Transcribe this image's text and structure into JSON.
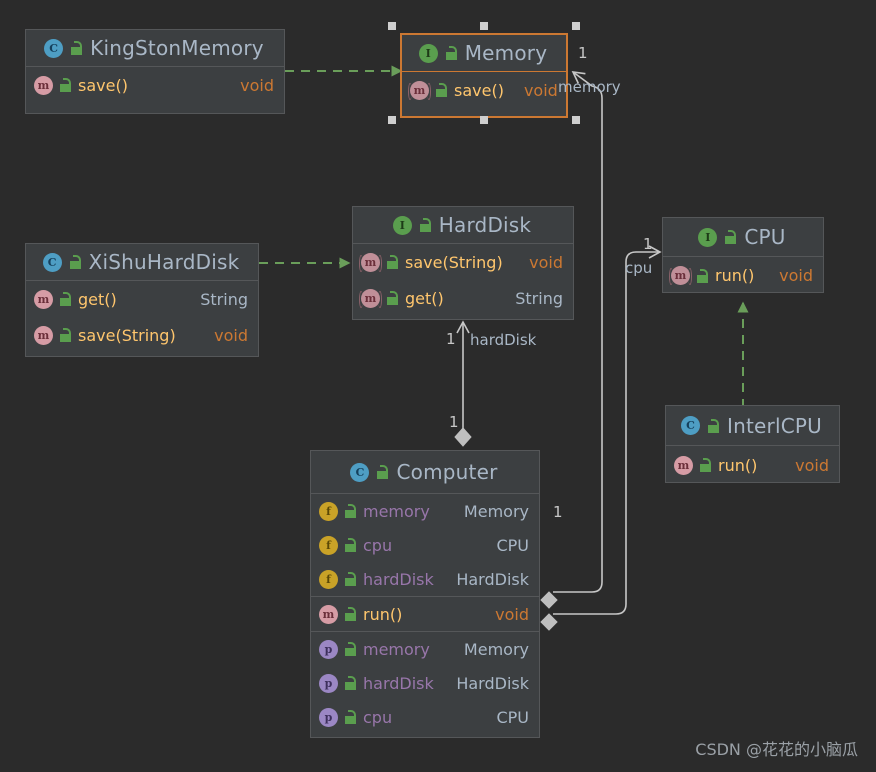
{
  "diagram": {
    "background": "#2b2b2b",
    "title": "UML Class Diagram",
    "colors": {
      "box_fill": "#3c3f41",
      "box_border": "#555759",
      "selection": "#cc7832",
      "inheritance": "#6a9e5a",
      "association": "#c7c7c7",
      "method_name": "#ffc66d",
      "field_name": "#9876aa",
      "type_void": "#cc7832",
      "type_ref": "#a9b7c6",
      "class_icon": "#4e9ec4",
      "interface_icon": "#5a9e4e",
      "method_icon": "#d69ca5",
      "field_icon": "#c9a227",
      "property_icon": "#9b87c4",
      "lock_icon": "#5a9e4e"
    }
  },
  "classes": {
    "kingstonmemory": {
      "name": "KingStonMemory",
      "stereotype_icon": "class-icon",
      "visibility_icon": "unlock-icon",
      "selected": false,
      "members": [
        {
          "icon": "method-icon",
          "abstract": false,
          "name": "save()",
          "type": "void",
          "type_kind": "void"
        }
      ]
    },
    "memory": {
      "name": "Memory",
      "stereotype_icon": "interface-icon",
      "visibility_icon": "unlock-icon",
      "selected": true,
      "members": [
        {
          "icon": "abstract-method-icon",
          "abstract": true,
          "name": "save()",
          "type": "void",
          "type_kind": "void"
        }
      ]
    },
    "xishuharddisk": {
      "name": "XiShuHardDisk",
      "stereotype_icon": "class-icon",
      "visibility_icon": "unlock-icon",
      "selected": false,
      "members": [
        {
          "icon": "method-icon",
          "abstract": false,
          "name": "get()",
          "type": "String",
          "type_kind": "ref"
        },
        {
          "icon": "method-icon",
          "abstract": false,
          "name": "save(String)",
          "type": "void",
          "type_kind": "void"
        }
      ]
    },
    "harddisk": {
      "name": "HardDisk",
      "stereotype_icon": "interface-icon",
      "visibility_icon": "unlock-icon",
      "selected": false,
      "members": [
        {
          "icon": "abstract-method-icon",
          "abstract": true,
          "name": "save(String)",
          "type": "void",
          "type_kind": "void"
        },
        {
          "icon": "abstract-method-icon",
          "abstract": true,
          "name": "get()",
          "type": "String",
          "type_kind": "ref"
        }
      ]
    },
    "cpu": {
      "name": "CPU",
      "stereotype_icon": "interface-icon",
      "visibility_icon": "unlock-icon",
      "selected": false,
      "members": [
        {
          "icon": "abstract-method-icon",
          "abstract": true,
          "name": "run()",
          "type": "void",
          "type_kind": "void"
        }
      ]
    },
    "interlcpu": {
      "name": "InterlCPU",
      "stereotype_icon": "class-icon",
      "visibility_icon": "unlock-icon",
      "selected": false,
      "members": [
        {
          "icon": "method-icon",
          "abstract": false,
          "name": "run()",
          "type": "void",
          "type_kind": "void"
        }
      ]
    },
    "computer": {
      "name": "Computer",
      "stereotype_icon": "class-icon",
      "visibility_icon": "unlock-icon",
      "selected": false,
      "fields": [
        {
          "icon": "field-icon",
          "name": "memory",
          "type": "Memory"
        },
        {
          "icon": "field-icon",
          "name": "cpu",
          "type": "CPU"
        },
        {
          "icon": "field-icon",
          "name": "hardDisk",
          "type": "HardDisk"
        }
      ],
      "methods": [
        {
          "icon": "method-icon",
          "name": "run()",
          "type": "void",
          "type_kind": "void"
        }
      ],
      "properties": [
        {
          "icon": "property-icon",
          "name": "memory",
          "type": "Memory"
        },
        {
          "icon": "property-icon",
          "name": "hardDisk",
          "type": "HardDisk"
        },
        {
          "icon": "property-icon",
          "name": "cpu",
          "type": "CPU"
        }
      ]
    }
  },
  "relations": {
    "kingstonmemory_memory": {
      "kind": "realization",
      "style": "dashed-green",
      "from": "KingStonMemory",
      "to": "Memory"
    },
    "xishuharddisk_harddisk": {
      "kind": "realization",
      "style": "dashed-green",
      "from": "XiShuHardDisk",
      "to": "HardDisk"
    },
    "interlcpu_cpu": {
      "kind": "realization",
      "style": "dashed-green",
      "from": "InterlCPU",
      "to": "CPU"
    },
    "computer_memory": {
      "kind": "aggregation",
      "style": "solid-gray",
      "from": "Computer",
      "to": "Memory",
      "label": "memory",
      "target_multiplicity": "1",
      "source_multiplicity": "1"
    },
    "computer_cpu": {
      "kind": "aggregation",
      "style": "solid-gray",
      "from": "Computer",
      "to": "CPU",
      "label": "cpu",
      "target_multiplicity": "1",
      "source_multiplicity": "1"
    },
    "computer_harddisk": {
      "kind": "aggregation",
      "style": "solid-gray",
      "from": "Computer",
      "to": "HardDisk",
      "label": "hardDisk",
      "target_multiplicity": "1",
      "source_multiplicity": "1"
    }
  },
  "watermark": {
    "text": "CSDN @花花的小脑瓜"
  }
}
